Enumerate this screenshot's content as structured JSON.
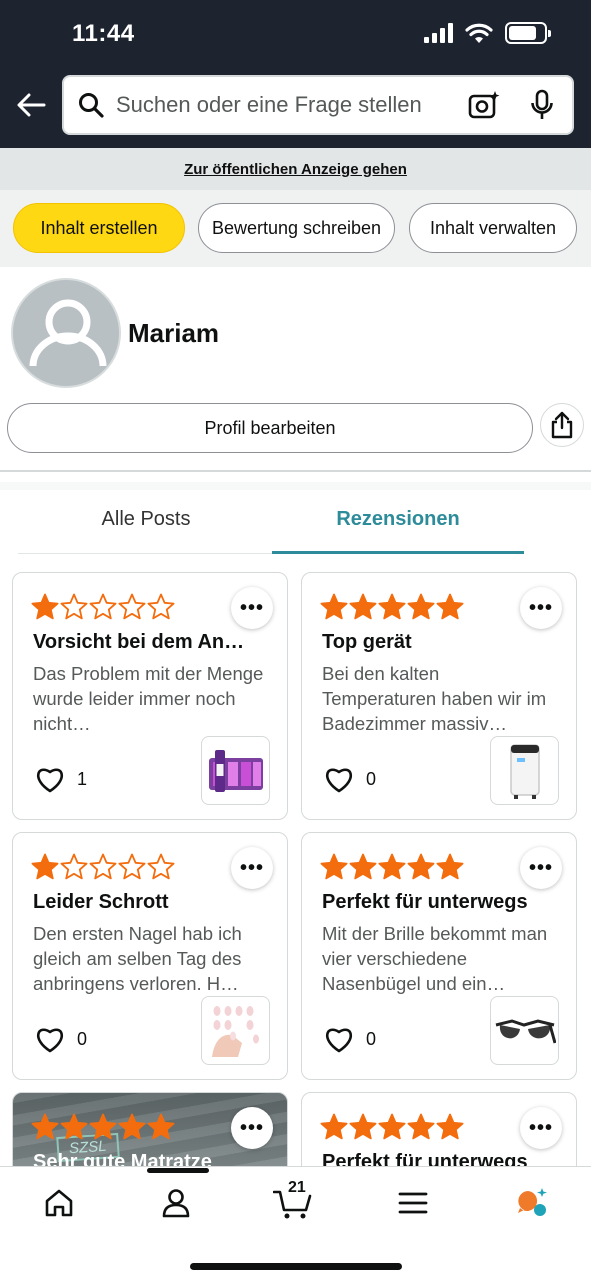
{
  "status_bar": {
    "time": "11:44",
    "battery_percent": 80
  },
  "search": {
    "placeholder": "Suchen oder eine Frage stellen"
  },
  "public_link": "Zur öffentlichen Anzeige gehen",
  "actions": {
    "create": "Inhalt erstellen",
    "write_review": "Bewertung schreiben",
    "manage": "Inhalt verwalten"
  },
  "profile": {
    "name": "Mariam",
    "edit_label": "Profil bearbeiten"
  },
  "tabs": [
    {
      "label": "Alle Posts",
      "active": false
    },
    {
      "label": "Rezensionen",
      "active": true
    }
  ],
  "colors": {
    "star": "#f36c0d",
    "accent": "#2e8c9a",
    "primary_button": "#ffd814",
    "header": "#1d2430"
  },
  "reviews": [
    {
      "rating": 1,
      "title": "Vorsicht bei dem An…",
      "body": "Das Problem mit der Menge wurde leider immer noch nicht…",
      "likes": "1",
      "product_icon": "energy-drink-pack-icon"
    },
    {
      "rating": 5,
      "title": "Top gerät",
      "body": "Bei den kalten Temperaturen haben wir im Badezimmer massiv…",
      "likes": "0",
      "product_icon": "dehumidifier-icon"
    },
    {
      "rating": 1,
      "title": "Leider Schrott",
      "body": "Den ersten Nagel hab ich gleich am selben Tag des anbringens verloren. H…",
      "likes": "0",
      "product_icon": "press-on-nails-icon"
    },
    {
      "rating": 5,
      "title": "Perfekt für unterwegs",
      "body": "Mit der Brille bekommt man vier verschiedene Nasenbügel und ein…",
      "likes": "0",
      "product_icon": "smart-glasses-icon"
    },
    {
      "rating": 5,
      "title": "Sehr gute Matratze",
      "photo_tag": "SZSL"
    },
    {
      "rating": 5,
      "title": "Perfekt für unterwegs"
    }
  ],
  "bottom_nav": {
    "cart_count": "21"
  }
}
